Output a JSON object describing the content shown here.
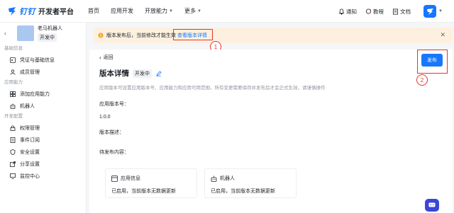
{
  "header": {
    "brand": "钉钉",
    "platform_title": "开发者平台",
    "nav": [
      {
        "label": "首页"
      },
      {
        "label": "应用开发"
      },
      {
        "label": "开放能力"
      },
      {
        "label": "更多"
      }
    ],
    "right": {
      "notify": "通知",
      "tutorial": "教程",
      "docs": "文档"
    }
  },
  "sidebar": {
    "app_name": "老马机器人",
    "app_status": "开发中",
    "groups": [
      {
        "title": "基础信息",
        "items": [
          {
            "label": "凭证与基础信息",
            "icon": "key-icon"
          },
          {
            "label": "成员管理",
            "icon": "person-icon"
          }
        ]
      },
      {
        "title": "应用能力",
        "items": [
          {
            "label": "添加应用能力",
            "icon": "grid-icon"
          },
          {
            "label": "机器人",
            "icon": "robot-icon"
          }
        ]
      },
      {
        "title": "开发配置",
        "items": [
          {
            "label": "权限管理",
            "icon": "lock-icon"
          },
          {
            "label": "事件订阅",
            "icon": "doc-icon"
          },
          {
            "label": "安全设置",
            "icon": "shield-icon"
          },
          {
            "label": "分享设置",
            "icon": "share-icon"
          },
          {
            "label": "监控中心",
            "icon": "monitor-icon"
          }
        ]
      }
    ]
  },
  "banner": {
    "text": "版本发布后，当前修改才能生效",
    "link": "查看版本详情"
  },
  "annotations": {
    "one": "1",
    "two": "2"
  },
  "detail": {
    "back": "返回",
    "title": "版本详情",
    "status_tag": "开发中",
    "publish": "发布",
    "description": "应用版本可设置应用版本号、应用能力和应用可用范围，所有变更需要保存并发布后才会正式生效，请谨慎操作",
    "version_label": "应用版本号：",
    "version_value": "1.0.0",
    "desc_label": "版本描述：",
    "pending_label": "待发布内容：",
    "cards": [
      {
        "title": "应用信息",
        "icon": "app-info-icon",
        "desc": "已启用，当前版本无数据更新"
      },
      {
        "title": "机器人",
        "icon": "robot-icon",
        "desc": "已启用，当前版本无数据更新"
      }
    ]
  },
  "colors": {
    "primary": "#1677ff",
    "banner_bg": "#fdf0df",
    "annotation": "#e0372d"
  }
}
